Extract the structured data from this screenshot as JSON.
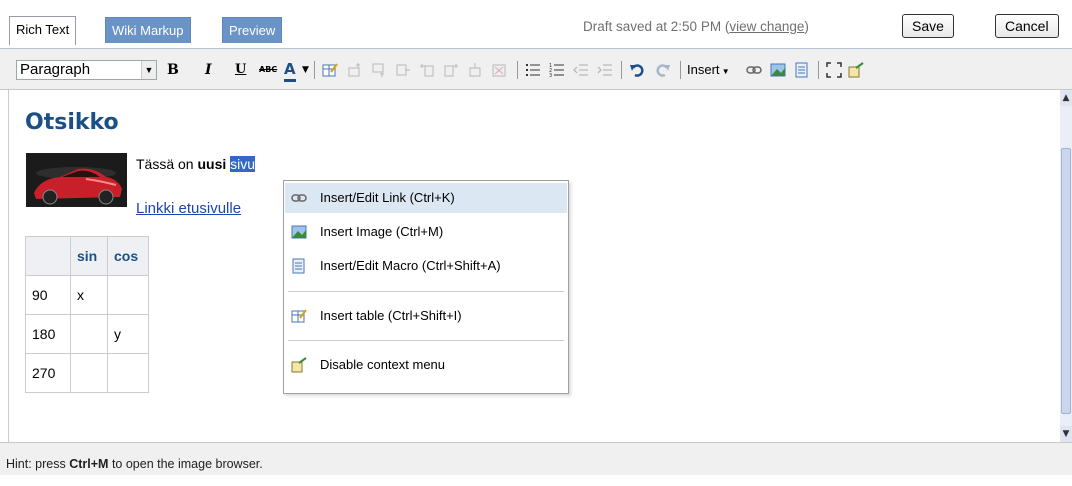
{
  "tabs": [
    {
      "label": "Rich Text",
      "active": true
    },
    {
      "label": "Wiki Markup",
      "active": false
    },
    {
      "label": "Preview",
      "active": false
    }
  ],
  "draft": {
    "text": "Draft saved at 2:50 PM",
    "link": "view change",
    "open": "(",
    "close": ")"
  },
  "buttons": {
    "save": "Save",
    "cancel": "Cancel"
  },
  "toolbar": {
    "style_select": "Paragraph",
    "bold": "B",
    "italic": "I",
    "underline": "U",
    "strike": "ABC",
    "color": "A",
    "insert": "Insert"
  },
  "editor": {
    "heading": "Otsikko",
    "para_pre": "Tässä on ",
    "para_bold": "uusi",
    "para_space": " ",
    "para_selected": "sivu",
    "link": "Linkki etusivulle",
    "table": {
      "header": [
        "",
        "sin",
        "cos"
      ],
      "rows": [
        [
          "90",
          "x",
          ""
        ],
        [
          "180",
          "",
          "y"
        ],
        [
          "270",
          "",
          ""
        ]
      ]
    }
  },
  "context_menu": {
    "items": [
      {
        "label": "Insert/Edit Link (Ctrl+K)",
        "icon": "link-icon",
        "highlighted": true
      },
      {
        "label": "Insert Image (Ctrl+M)",
        "icon": "image-icon"
      },
      {
        "label": "Insert/Edit Macro (Ctrl+Shift+A)",
        "icon": "macro-icon"
      },
      {
        "label": "Insert table (Ctrl+Shift+I)",
        "icon": "table-icon"
      },
      {
        "label": "Disable context menu",
        "icon": "disable-menu-icon"
      }
    ]
  },
  "status": {
    "hint_pre": "Hint: press ",
    "hint_key": "Ctrl+M",
    "hint_post": " to open the image browser."
  },
  "colors": {
    "accent": "#6a93c8",
    "heading": "#1d4f87",
    "link": "#2342b1",
    "selection": "#3369c6",
    "menu_highlight": "#dbe8f4"
  }
}
